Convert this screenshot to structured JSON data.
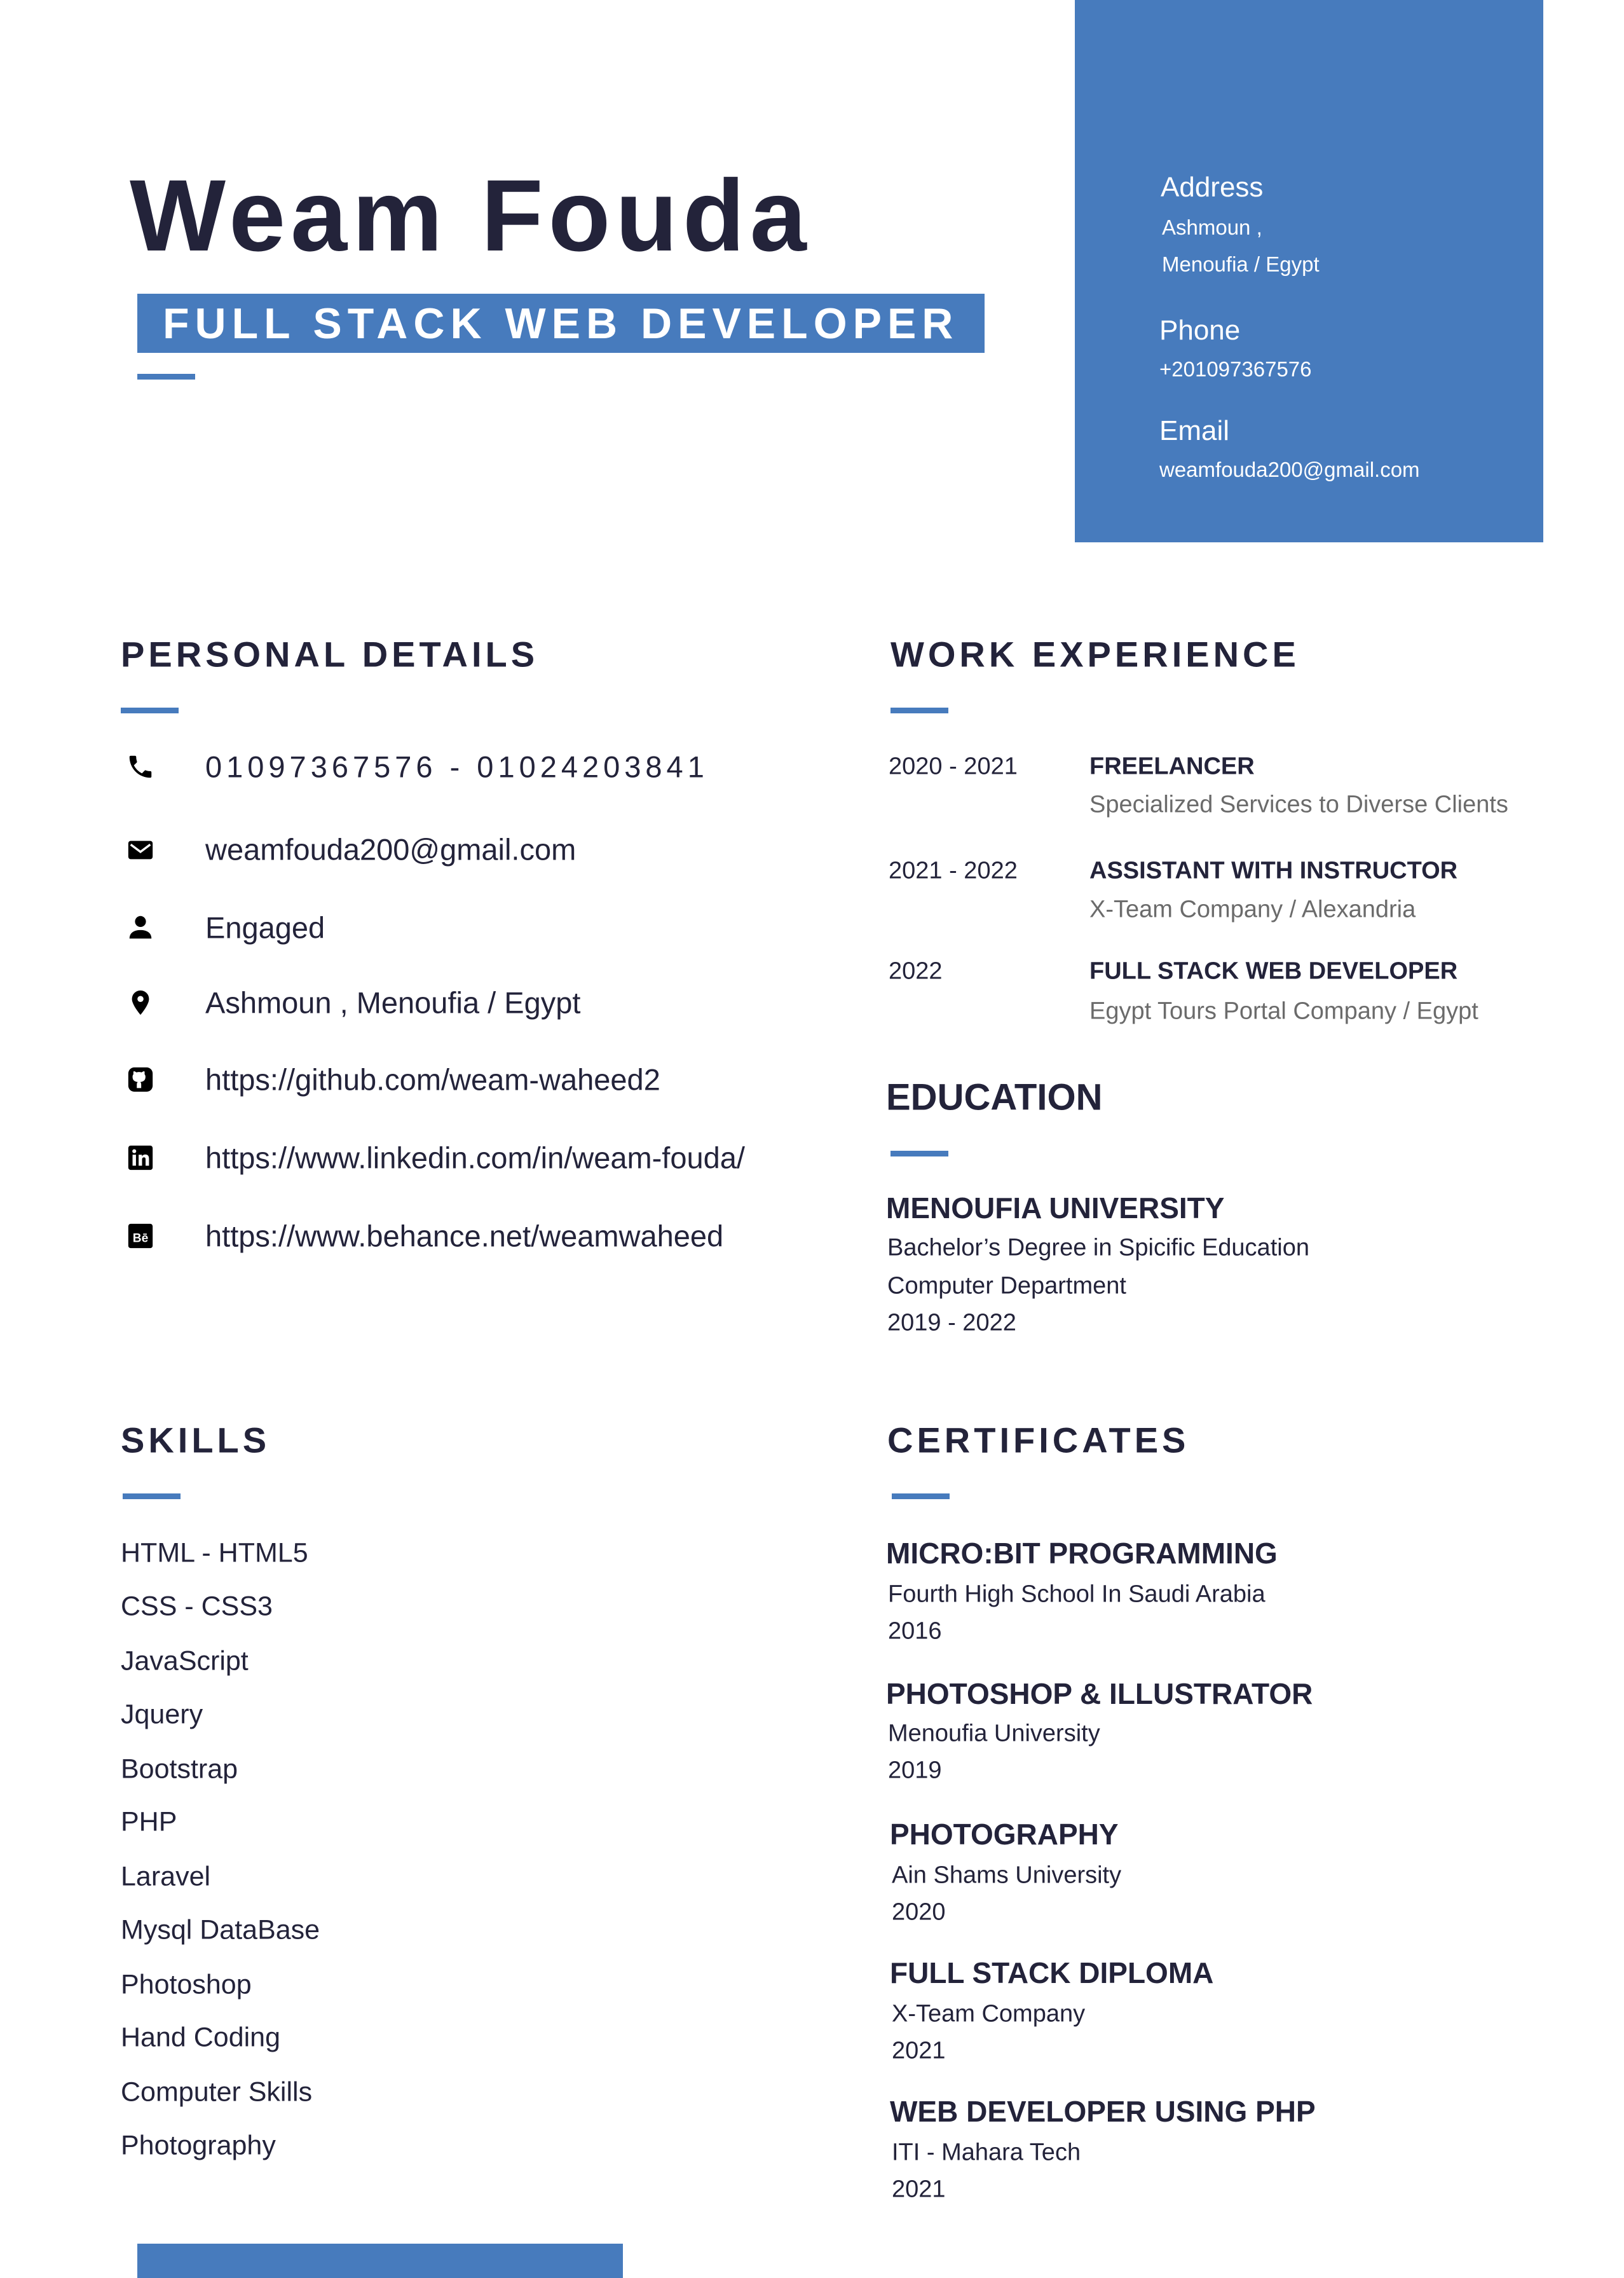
{
  "header": {
    "name": "Weam Fouda",
    "title": "FULL STACK WEB DEVELOPER"
  },
  "side": {
    "address_label": "Address",
    "address_line1": "Ashmoun ,",
    "address_line2": "Menoufia / Egypt",
    "phone_label": "Phone",
    "phone": "+201097367576",
    "email_label": "Email",
    "email": "weamfouda200@gmail.com"
  },
  "personal": {
    "heading": "PERSONAL DETAILS",
    "items": [
      {
        "icon": "phone-icon",
        "text": "01097367576 - 01024203841"
      },
      {
        "icon": "envelope-icon",
        "text": "weamfouda200@gmail.com"
      },
      {
        "icon": "person-icon",
        "text": "Engaged"
      },
      {
        "icon": "location-pin-icon",
        "text": "Ashmoun , Menoufia / Egypt"
      },
      {
        "icon": "github-icon",
        "text": "https://github.com/weam-waheed2"
      },
      {
        "icon": "linkedin-icon",
        "text": "https://www.linkedin.com/in/weam-fouda/"
      },
      {
        "icon": "behance-icon",
        "text": "https://www.behance.net/weamwaheed"
      }
    ]
  },
  "work": {
    "heading": "WORK EXPERIENCE",
    "items": [
      {
        "years": "2020 - 2021",
        "title": "FREELANCER",
        "sub": "Specialized Services to Diverse Clients"
      },
      {
        "years": "2021 - 2022",
        "title": "ASSISTANT WITH INSTRUCTOR",
        "sub": "X-Team Company / Alexandria"
      },
      {
        "years": "2022",
        "title": "FULL STACK WEB DEVELOPER",
        "sub": "Egypt Tours Portal Company / Egypt"
      }
    ]
  },
  "education": {
    "heading": "EDUCATION",
    "school": "MENOUFIA UNIVERSITY",
    "degree": "Bachelor’s Degree in Spicific Education",
    "dept": "Computer Department",
    "years": "2019 - 2022"
  },
  "skills": {
    "heading": "SKILLS",
    "items": [
      "HTML - HTML5",
      "CSS - CSS3",
      "JavaScript",
      "Jquery",
      "Bootstrap",
      "PHP",
      "Laravel",
      "Mysql DataBase",
      "Photoshop",
      "Hand Coding",
      "Computer Skills",
      "Photography"
    ]
  },
  "certificates": {
    "heading": "CERTIFICATES",
    "items": [
      {
        "title": "MICRO:BIT PROGRAMMING",
        "sub": "Fourth High School In Saudi Arabia",
        "year": "2016"
      },
      {
        "title": "PHOTOSHOP & ILLUSTRATOR",
        "sub": "Menoufia University",
        "year": "2019"
      },
      {
        "title": "PHOTOGRAPHY",
        "sub": "Ain Shams University",
        "year": "2020"
      },
      {
        "title": "FULL STACK DIPLOMA",
        "sub": "X-Team Company",
        "year": "2021"
      },
      {
        "title": "WEB DEVELOPER USING PHP",
        "sub": "ITI - Mahara Tech",
        "year": "2021"
      }
    ]
  },
  "colors": {
    "accent": "#477bbd",
    "text": "#23233a"
  }
}
